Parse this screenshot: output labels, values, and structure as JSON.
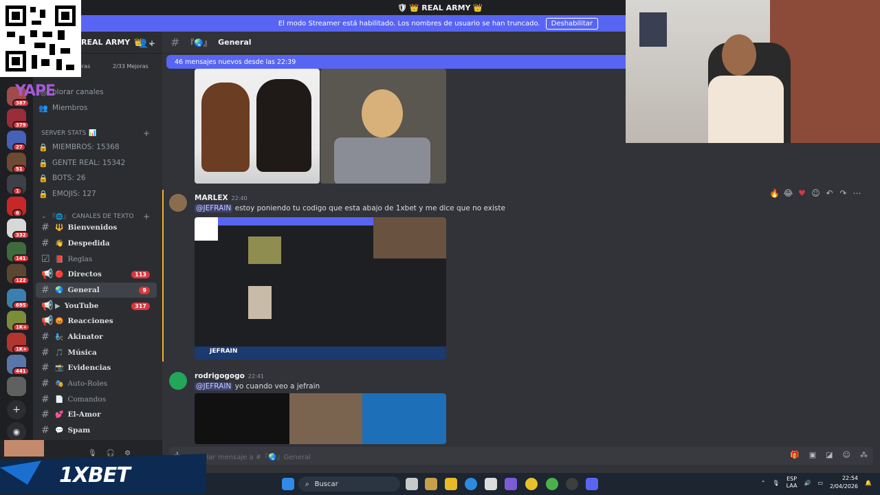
{
  "window": {
    "title": "REAL ARMY"
  },
  "banner": {
    "text": "El modo Streamer está habilitado. Los nombres de usuario se han truncado.",
    "button": "Deshabilitar"
  },
  "server": {
    "name": "REAL ARMY",
    "boost_left": "oras",
    "boost_right": "2/33 Mejoras",
    "invite_icon": "add-person-icon"
  },
  "server_rail": {
    "badges": [
      "387",
      "379",
      "27",
      "51",
      "1",
      "6",
      "332",
      "141",
      "122",
      "695",
      "1K+",
      "1K+",
      "441"
    ]
  },
  "sidebar": {
    "top_links": [
      {
        "label": "plorar canales",
        "icon": "compass-icon"
      },
      {
        "label": "Miembros",
        "icon": "members-icon"
      }
    ],
    "stats_category": "SERVER STATS",
    "stats": [
      {
        "label": "MIEMBROS: 15368"
      },
      {
        "label": "GENTE REAL: 15342"
      },
      {
        "label": "BOTS: 26"
      },
      {
        "label": "EMOJIS: 127"
      }
    ],
    "text_category": "CANALES DE TEXTO",
    "channels": [
      {
        "name": "Bienvenidos",
        "prefix": "『",
        "emoji": "🔱",
        "badge": ""
      },
      {
        "name": "Despedida",
        "prefix": "『",
        "emoji": "👋",
        "badge": ""
      },
      {
        "name": "Reglas",
        "prefix": "『",
        "emoji": "📕",
        "badge": ""
      },
      {
        "name": "Directos",
        "prefix": "『",
        "emoji": "🔴",
        "badge": "113"
      },
      {
        "name": "General",
        "prefix": "『",
        "emoji": "🌏",
        "badge": "9"
      },
      {
        "name": "YouTube",
        "prefix": "『",
        "emoji": "▶",
        "badge": "317"
      },
      {
        "name": "Reacciones",
        "prefix": "『",
        "emoji": "😡",
        "badge": ""
      },
      {
        "name": "Akinator",
        "prefix": "『",
        "emoji": "🧞",
        "badge": ""
      },
      {
        "name": "Música",
        "prefix": "『",
        "emoji": "🎵",
        "badge": ""
      },
      {
        "name": "Evidencias",
        "prefix": "『",
        "emoji": "📸",
        "badge": ""
      },
      {
        "name": "Auto-Roles",
        "prefix": "『",
        "emoji": "🎭",
        "badge": ""
      },
      {
        "name": "Comandos",
        "prefix": "『",
        "emoji": "📄",
        "badge": ""
      },
      {
        "name": "El-Amor",
        "prefix": "『",
        "emoji": "💕",
        "badge": ""
      },
      {
        "name": "Spam",
        "prefix": "『",
        "emoji": "💬",
        "badge": ""
      }
    ]
  },
  "header": {
    "channel": "General",
    "prefix": "『🌏』"
  },
  "new_messages": "46 mensajes nuevos desde las 22:39",
  "messages": [
    {
      "author": "MARLEX",
      "time": "22:40",
      "mention": "@JEFRAIN",
      "text": " estoy poniendo tu codigo que esta abajo de 1xbet y me dice que no existe"
    },
    {
      "author": "rodrigogogo",
      "time": "22:41",
      "mention": "@JEFRAIN",
      "text": " yo cuando veo a jefrain"
    }
  ],
  "embed_caption": "JEFRAIN",
  "composer": {
    "placeholder": "Enviar mensaje a #『🌏』General"
  },
  "overlay": {
    "yape": "YAPE",
    "bet": "1XBET"
  },
  "taskbar": {
    "search": "Buscar",
    "lang_top": "ESP",
    "lang_bottom": "LAA",
    "time": "22:54",
    "date": "2/04/2026"
  },
  "colors": {
    "accent": "#5865f2",
    "badge": "#da373c",
    "bg": "#313338",
    "sidebar": "#2b2d31"
  }
}
